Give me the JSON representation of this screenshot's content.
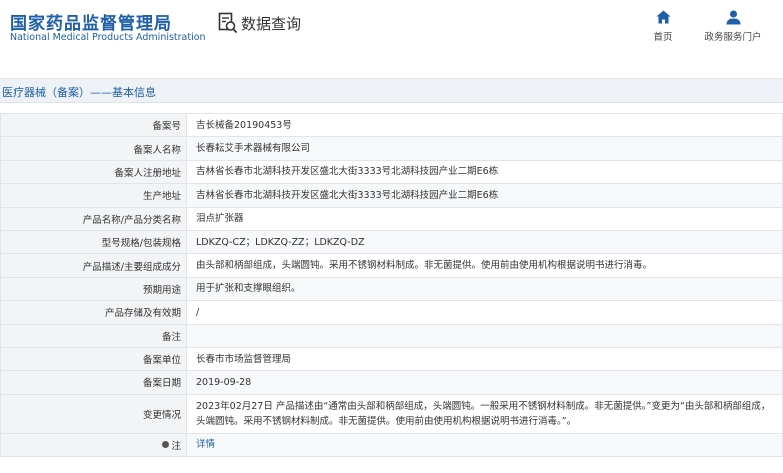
{
  "header": {
    "logo_cn": "国家药品监督管理局",
    "logo_en": "National Medical Products Administration",
    "query_label": "数据查询",
    "nav": [
      {
        "label": "首页",
        "icon": "home-icon"
      },
      {
        "label": "政务服务门户",
        "icon": "user-icon"
      }
    ]
  },
  "section": {
    "title": "医疗器械（备案）——基本信息"
  },
  "fields": [
    {
      "label": "备案号",
      "value": "吉长械备20190453号"
    },
    {
      "label": "备案人名称",
      "value": "长春耘艾手术器械有限公司"
    },
    {
      "label": "备案人注册地址",
      "value": "吉林省长春市北湖科技开发区盛北大街3333号北湖科技园产业二期E6栋"
    },
    {
      "label": "生产地址",
      "value": "吉林省长春市北湖科技开发区盛北大街3333号北湖科技园产业二期E6栋"
    },
    {
      "label": "产品名称/产品分类名称",
      "value": "泪点扩张器"
    },
    {
      "label": "型号规格/包装规格",
      "value": "LDKZQ-CZ；LDKZQ-ZZ；LDKZQ-DZ"
    },
    {
      "label": "产品描述/主要组成成分",
      "value": "由头部和柄部组成，头端圆钝。采用不锈钢材料制成。非无菌提供。使用前由使用机构根据说明书进行消毒。"
    },
    {
      "label": "预期用途",
      "value": "用于扩张和支撑眼组织。"
    },
    {
      "label": "产品存储及有效期",
      "value": "/"
    },
    {
      "label": "备注",
      "value": ""
    },
    {
      "label": "备案单位",
      "value": "长春市市场监督管理局"
    },
    {
      "label": "备案日期",
      "value": "2019-09-28"
    },
    {
      "label": "变更情况",
      "value": "2023年02月27日 产品描述由“通常由头部和柄部组成，头端圆钝。一般采用不锈钢材料制成。非无菌提供。”变更为“由头部和柄部组成，头端圆钝。采用不锈钢材料制成。非无菌提供。使用前由使用机构根据说明书进行消毒。”。"
    },
    {
      "label": "注",
      "value": "详情"
    }
  ],
  "colors": {
    "brand_blue": "#1e5fa8",
    "label_bg": "#f3f4f6",
    "border": "#e1e4e8"
  }
}
